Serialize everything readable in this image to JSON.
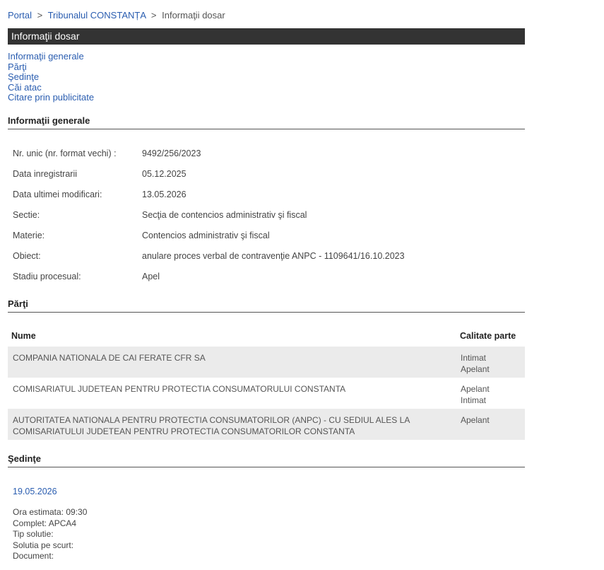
{
  "breadcrumb": {
    "items": [
      "Portal",
      "Tribunalul CONSTANȚA",
      "Informaţii dosar"
    ],
    "separator": ">"
  },
  "title_bar": {
    "label": "Informaţii dosar"
  },
  "anchors": [
    "Informaţii generale",
    "Părţi",
    "Şedinţe",
    "Căi atac",
    "Citare prin publicitate"
  ],
  "sections": {
    "general": "Informaţii generale",
    "parti": "Părţi",
    "sedinte": "Şedinţe"
  },
  "general_info": [
    {
      "label": "Nr. unic (nr. format vechi) :",
      "value": "9492/256/2023"
    },
    {
      "label": "Data inregistrarii",
      "value": "05.12.2025"
    },
    {
      "label": "Data ultimei modificari:",
      "value": "13.05.2026"
    },
    {
      "label": "Sectie:",
      "value": "Secţia de contencios administrativ şi fiscal"
    },
    {
      "label": "Materie:",
      "value": "Contencios administrativ şi fiscal"
    },
    {
      "label": "Obiect:",
      "value": "anulare proces verbal de contravenţie ANPC - 1109641/16.10.2023"
    },
    {
      "label": "Stadiu procesual:",
      "value": "Apel"
    }
  ],
  "parti_table": {
    "headers": {
      "nume": "Nume",
      "calitate": "Calitate parte"
    },
    "rows": [
      {
        "nume_line1": "COMPANIA NATIONALA DE CAI FERATE CFR SA",
        "nume_line2": "",
        "calitate_line1": "Intimat",
        "calitate_line2": "Apelant"
      },
      {
        "nume_line1": "COMISARIATUL JUDETEAN PENTRU PROTECTIA CONSUMATORULUI CONSTANTA",
        "nume_line2": "",
        "calitate_line1": "Apelant",
        "calitate_line2": "Intimat"
      },
      {
        "nume_line1": "AUTORITATEA NATIONALA PENTRU PROTECTIA CONSUMATORILOR (ANPC) - CU SEDIUL ALES LA",
        "nume_line2": "COMISARIATULUI JUDETEAN PENTRU PROTECTIA CONSUMATORILOR CONSTANTA",
        "calitate_line1": "Apelant",
        "calitate_line2": ""
      }
    ]
  },
  "sedinta": {
    "date": "19.05.2026",
    "details": [
      "Ora estimata: 09:30",
      "Complet: APCA4",
      "Tip solutie:",
      "Solutia pe scurt:",
      "Document:"
    ]
  },
  "colors": {
    "title_bar_bg": "#333333",
    "link": "#2a5db0",
    "row_alt_bg": "#ebebeb"
  }
}
